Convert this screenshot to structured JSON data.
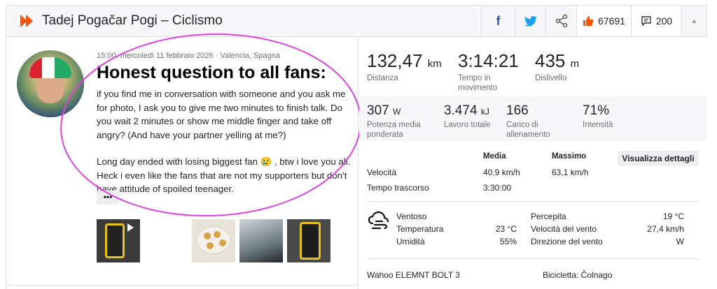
{
  "header": {
    "title": "Tadej Pogačar Pogi – Ciclismo",
    "kudos": "67691",
    "comments": "200"
  },
  "activity": {
    "meta": "15:00, mercoledì 11 febbraio 2026 · Valencia, Spagna",
    "title": "Honest question to all fans:",
    "paragraph1": "if you find me in conversation with someone and you ask me for photo, I ask you to give me two minutes to finish talk. Do you wait 2 minutes or show me middle finger and take off angry? (And have your partner yelling at me?)",
    "paragraph2": "Long day ended with losing biggest fan 😢 , btw i love you all. Heck i even like the fans that are not my supporters but don't have attitude of spoiled teenager.",
    "more": "•••"
  },
  "stats": {
    "distance": {
      "value": "132,47",
      "unit": "km",
      "label": "Distanza"
    },
    "moving_time": {
      "value": "3:14:21",
      "label1": "Tempo in",
      "label2": "movimento"
    },
    "elevation": {
      "value": "435",
      "unit": "m",
      "label": "Dislivello"
    },
    "power": {
      "value": "307",
      "unit": "W",
      "label1": "Potenza media",
      "label2": "ponderata"
    },
    "work": {
      "value": "3.474",
      "unit": "kJ",
      "label": "Lavoro totale"
    },
    "load": {
      "value": "166",
      "label1": "Carico di",
      "label2": "allenamento"
    },
    "intensity": {
      "value": "71%",
      "label": "Intensità"
    }
  },
  "table": {
    "col_avg": "Media",
    "col_max": "Massimo",
    "details_button": "Visualizza dettagli",
    "speed_label": "Velocità",
    "speed_avg": "40,9 km/h",
    "speed_max": "63,1 km/h",
    "elapsed_label": "Tempo trascorso",
    "elapsed_value": "3:30:00"
  },
  "weather": {
    "condition": "Ventoso",
    "temp_label": "Temperatura",
    "temp_value": "23 °C",
    "humidity_label": "Umidità",
    "humidity_value": "55%",
    "feels_label": "Percepita",
    "feels_value": "19 °C",
    "wind_speed_label": "Velocità del vento",
    "wind_speed_value": "27,4 km/h",
    "wind_dir_label": "Direzione del vento",
    "wind_dir_value": "W"
  },
  "footer": {
    "device": "Wahoo ELEMNT BOLT 3",
    "bike": "Bicicletta: Čolnago"
  },
  "colors": {
    "brand": "#fc5200",
    "annotation": "#e040e0",
    "facebook": "#3b5998",
    "twitter": "#1da1f2"
  }
}
